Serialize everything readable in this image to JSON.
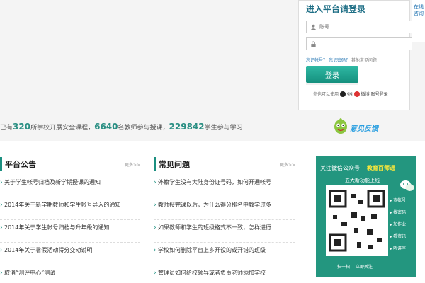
{
  "hero": {
    "stats": {
      "prefix": "已有",
      "schools": "320",
      "schools_text": "所学校开展安全课程，",
      "teachers": "6640",
      "teachers_text": "名教师参与授课，",
      "students": "229842",
      "students_text": "学生参与学习"
    }
  },
  "login": {
    "title": "进入平台请登录",
    "username_placeholder": "账号",
    "password_placeholder": "",
    "forgot_account": "忘记帐号？",
    "forgot_password": "忘记密码？",
    "help": "其他常见问题",
    "submit_label": "登录",
    "third_party_prefix": "你也可以使用",
    "qq_label": "qq",
    "weibo_label": "微博",
    "account_login": "账号登录"
  },
  "side_tab": {
    "label": "在线咨询"
  },
  "feedback": {
    "label": "意见反馈"
  },
  "notice": {
    "title": "平台公告",
    "more": "更多>>",
    "items": [
      "关于学生帐号归档及新学期授课的通知",
      "2014年关于新学期教师和学生帐号导入的通知",
      "2014年关于学生帐号归档与升年级的通知",
      "2014年关于暑假活动得分变动说明",
      "取消“测评中心”测试"
    ]
  },
  "faq": {
    "title": "常见问题",
    "more": "更多>>",
    "items": [
      "外籍学生没有大陆身份证号码，如何开通帐号",
      "教师授完课以后，为什么得分排名中教学过多",
      "如果教师和学生的班级格式不一致，怎样进行",
      "学校如何删除平台上多开设的或开错的班级",
      "管理员如何给校领导或者负责老师添加学校"
    ]
  },
  "wechat": {
    "title": "关注微信公众号",
    "brand": "教育百师通",
    "subtitle": "五大新功能上线",
    "menu": [
      "查帐号",
      "找密码",
      "加作业",
      "看资讯",
      "听讲座"
    ],
    "scan_label": "扫一扫",
    "follow_label": "立即关注",
    "colors": {
      "background": "#23967f",
      "highlight": "#ffea3a"
    }
  },
  "colors": {
    "accent": "#1b8f80",
    "stats_number": "#2a8f83",
    "link": "#2b7ab5"
  },
  "icons": [
    "user-icon",
    "lock-icon",
    "qq-icon",
    "weibo-icon",
    "feedback-mascot-icon",
    "wechat-logo-icon",
    "qr-code"
  ]
}
